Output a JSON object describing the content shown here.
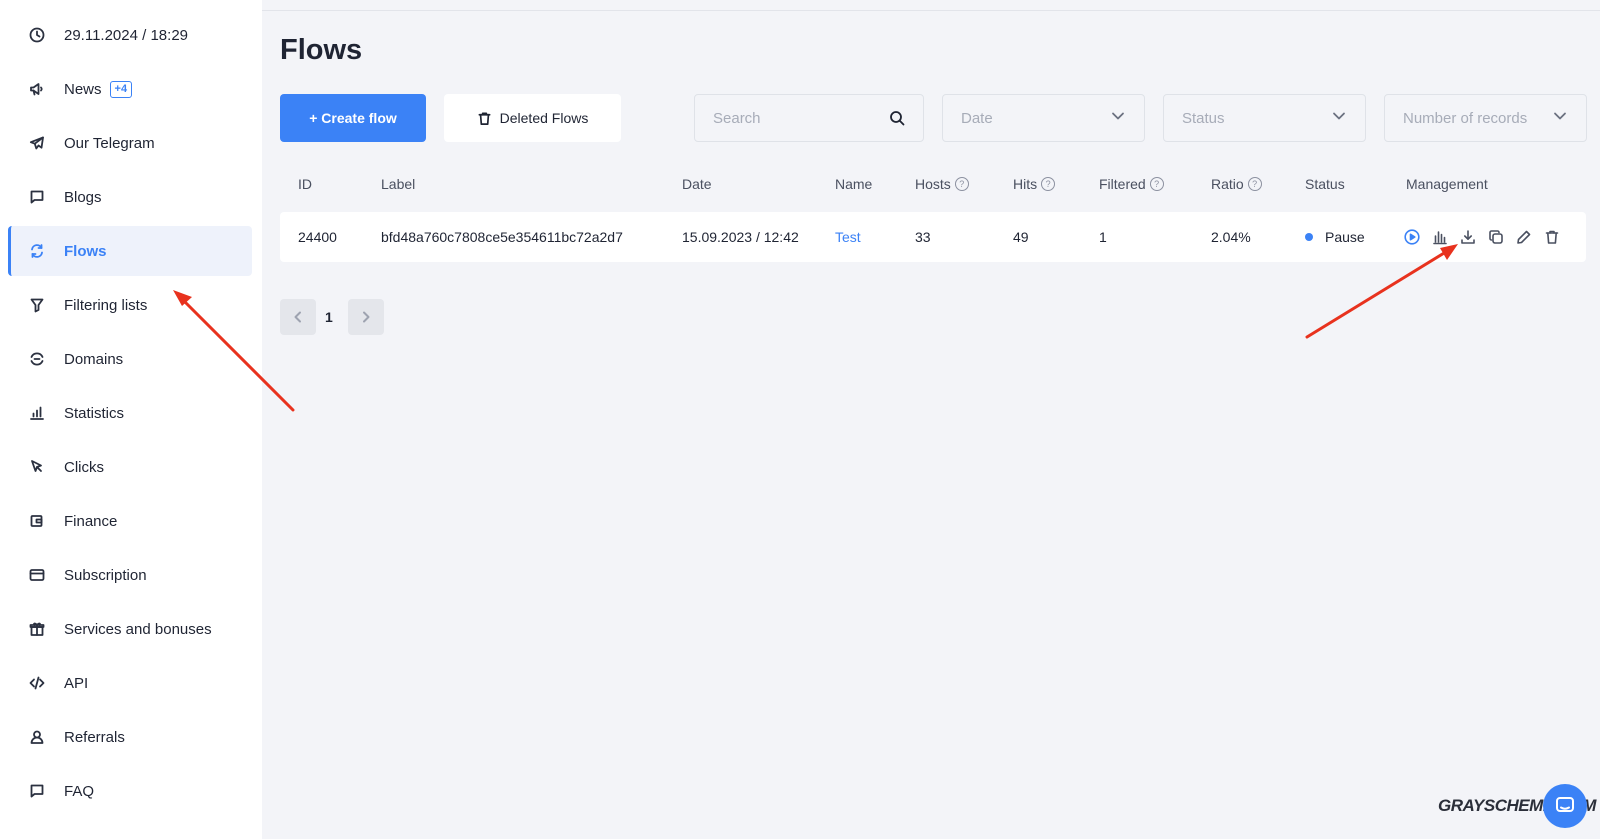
{
  "sidebar": {
    "items": [
      {
        "label": "29.11.2024 / 18:29",
        "icon": "clock-icon"
      },
      {
        "label": "News",
        "icon": "megaphone-icon",
        "badge": "+4"
      },
      {
        "label": "Our Telegram",
        "icon": "telegram-icon"
      },
      {
        "label": "Blogs",
        "icon": "chat-icon"
      },
      {
        "label": "Flows",
        "icon": "refresh-icon",
        "active": true
      },
      {
        "label": "Filtering lists",
        "icon": "filter-icon"
      },
      {
        "label": "Domains",
        "icon": "domains-icon"
      },
      {
        "label": "Statistics",
        "icon": "bar-chart-icon"
      },
      {
        "label": "Clicks",
        "icon": "cursor-icon"
      },
      {
        "label": "Finance",
        "icon": "wallet-icon"
      },
      {
        "label": "Subscription",
        "icon": "card-icon"
      },
      {
        "label": "Services and bonuses",
        "icon": "gift-icon"
      },
      {
        "label": "API",
        "icon": "code-icon"
      },
      {
        "label": "Referrals",
        "icon": "user-icon"
      },
      {
        "label": "FAQ",
        "icon": "faq-icon"
      }
    ]
  },
  "main": {
    "title": "Flows",
    "create_label": "+ Create flow",
    "deleted_label": "Deleted Flows",
    "search_placeholder": "Search",
    "date_placeholder": "Date",
    "status_placeholder": "Status",
    "records_placeholder": "Number of records"
  },
  "table": {
    "headers": {
      "id": "ID",
      "label": "Label",
      "date": "Date",
      "name": "Name",
      "hosts": "Hosts",
      "hits": "Hits",
      "filtered": "Filtered",
      "ratio": "Ratio",
      "status": "Status",
      "management": "Management"
    },
    "rows": [
      {
        "id": "24400",
        "label": "bfd48a760c7808ce5e354611bc72a2d7",
        "date": "15.09.2023 / 12:42",
        "name": "Test",
        "hosts": "33",
        "hits": "49",
        "filtered": "1",
        "ratio": "2.04%",
        "status": "Pause"
      }
    ]
  },
  "pagination": {
    "current": "1"
  },
  "watermark": "GRAYSCHEME.COM",
  "colors": {
    "accent": "#3b82f6",
    "arrow": "#e8321e"
  }
}
